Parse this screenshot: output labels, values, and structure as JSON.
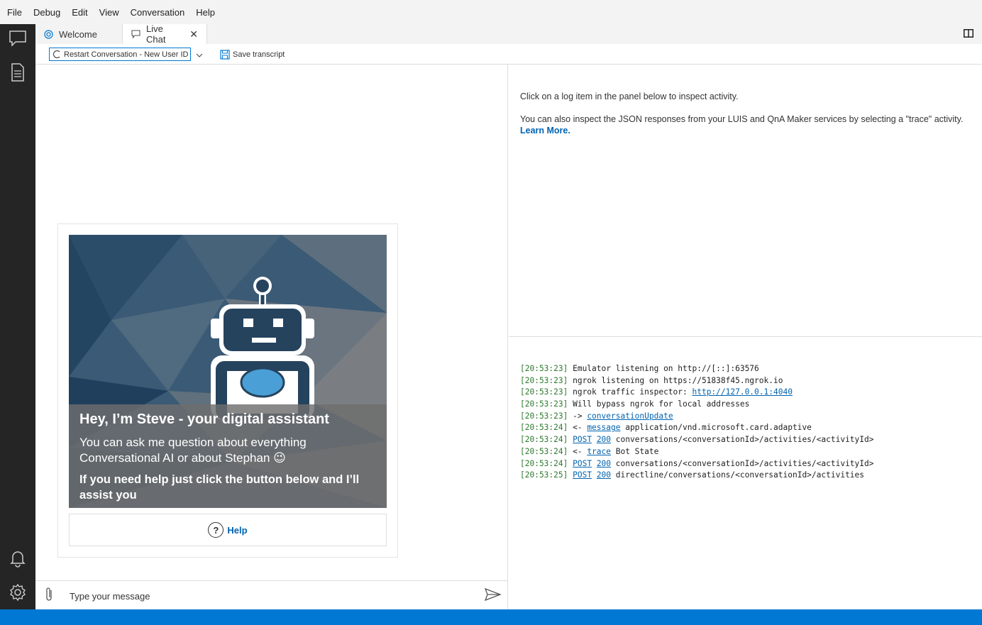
{
  "menu": [
    "File",
    "Debug",
    "Edit",
    "View",
    "Conversation",
    "Help"
  ],
  "tabs": [
    {
      "label": "Welcome",
      "icon": "globe-icon"
    },
    {
      "label": "Live Chat",
      "icon": "chat-icon",
      "close": "✕"
    }
  ],
  "toolbar": {
    "restart_label": "Restart Conversation - New User ID",
    "save_label": "Save transcript"
  },
  "card": {
    "title": "Hey, I’m Steve - your digital assistant",
    "body": "You can ask me question about everything Conversational AI or about Stephan 😉",
    "body2": "If you need help just click the button below and I’ll assist you",
    "help_label": "Help"
  },
  "input": {
    "placeholder": "Type your message"
  },
  "inspector": {
    "line1": "Click on a log item in the panel below to inspect activity.",
    "line2": "You can also inspect the JSON responses from your LUIS and QnA Maker services by selecting a \"trace\" activity.",
    "learn_more": "Learn More."
  },
  "log": [
    {
      "ts": "[20:53:23]",
      "pre": " Emulator listening on http://[::]:63576",
      "link": "",
      "link2": "",
      "post": ""
    },
    {
      "ts": "[20:53:23]",
      "pre": " ngrok listening on https://51838f45.ngrok.io",
      "link": "",
      "link2": "",
      "post": ""
    },
    {
      "ts": "[20:53:23]",
      "pre": " ngrok traffic inspector: ",
      "link": "http://127.0.0.1:4040",
      "link2": "",
      "post": ""
    },
    {
      "ts": "[20:53:23]",
      "pre": " Will bypass ngrok for local addresses",
      "link": "",
      "link2": "",
      "post": ""
    },
    {
      "ts": "[20:53:23]",
      "pre": " -> ",
      "link": "conversationUpdate",
      "link2": "",
      "post": ""
    },
    {
      "ts": "[20:53:24]",
      "pre": " <- ",
      "link": "message",
      "link2": "",
      "post": " application/vnd.microsoft.card.adaptive"
    },
    {
      "ts": "[20:53:24]",
      "pre": " ",
      "link": "POST",
      "link2": "200",
      "post": " conversations/<conversationId>/activities/<activityId>"
    },
    {
      "ts": "[20:53:24]",
      "pre": " <- ",
      "link": "trace",
      "link2": "",
      "post": " Bot State"
    },
    {
      "ts": "[20:53:24]",
      "pre": " ",
      "link": "POST",
      "link2": "200",
      "post": " conversations/<conversationId>/activities/<activityId>"
    },
    {
      "ts": "[20:53:25]",
      "pre": " ",
      "link": "POST",
      "link2": "200",
      "post": " directline/conversations/<conversationId>/activities"
    }
  ],
  "colors": {
    "accent": "#0078d4",
    "activitybar": "#252526",
    "timestamp": "#2d7a2d",
    "link": "#0063b1"
  }
}
